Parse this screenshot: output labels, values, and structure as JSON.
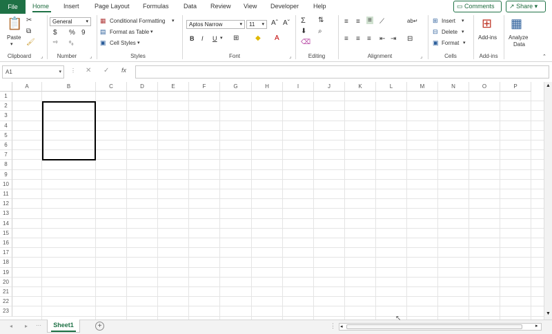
{
  "menu": {
    "file": "File",
    "tabs": [
      "Home",
      "Insert",
      "Page Layout",
      "Formulas",
      "Data",
      "Review",
      "View",
      "Developer",
      "Help"
    ],
    "comments": "Comments",
    "share": "Share"
  },
  "ribbon": {
    "clipboard": {
      "paste": "Paste",
      "label": "Clipboard"
    },
    "number": {
      "format": "General",
      "currency": "$",
      "percent": "%",
      "comma": "9",
      "label": "Number"
    },
    "styles": {
      "conditional": "Conditional Formatting",
      "format_table": "Format as Table",
      "cell_styles": "Cell Styles",
      "label": "Styles"
    },
    "font": {
      "name": "Aptos Narrow",
      "size": "11",
      "bold": "B",
      "italic": "I",
      "underline": "U",
      "label": "Font"
    },
    "editing": {
      "label": "Editing"
    },
    "alignment": {
      "label": "Alignment"
    },
    "cells": {
      "insert": "Insert",
      "delete": "Delete",
      "format": "Format",
      "label": "Cells"
    },
    "addins": {
      "addins": "Add-ins",
      "label": "Add-ins"
    },
    "analyze": {
      "line1": "Analyze",
      "line2": "Data"
    }
  },
  "formula_bar": {
    "name_box": "A1",
    "fx": "fx",
    "cancel": "✕",
    "confirm": "✓",
    "value": ""
  },
  "grid": {
    "columns": [
      "A",
      "B",
      "C",
      "D",
      "E",
      "F",
      "G",
      "H",
      "I",
      "J",
      "K",
      "L",
      "M",
      "N",
      "O",
      "P"
    ],
    "rows": [
      "1",
      "2",
      "3",
      "4",
      "5",
      "6",
      "7",
      "8",
      "9",
      "10",
      "11",
      "12",
      "13",
      "14",
      "15",
      "16",
      "17",
      "18",
      "19",
      "20",
      "21",
      "22",
      "23"
    ]
  },
  "sheets": {
    "active": "Sheet1",
    "add": "+"
  }
}
